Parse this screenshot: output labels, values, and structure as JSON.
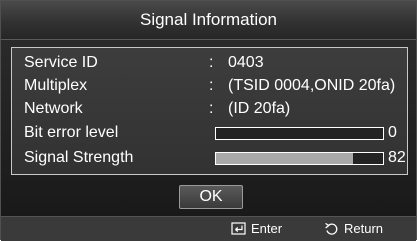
{
  "window": {
    "title": "Signal Information"
  },
  "info": {
    "rows": [
      {
        "label": "Service ID",
        "value": "0403"
      },
      {
        "label": "Multiplex",
        "value": "(TSID 0004,ONID 20fa)"
      },
      {
        "label": "Network",
        "value": "(ID 20fa)"
      }
    ],
    "bit_error": {
      "label": "Bit error level",
      "value": "0",
      "level": 0
    },
    "signal": {
      "label": "Signal Strength",
      "value": "82",
      "level": 82
    },
    "colon": ":"
  },
  "buttons": {
    "ok_label": "OK"
  },
  "footer": {
    "enter_icon": "enter-icon",
    "enter_label": "Enter",
    "return_icon": "return-icon",
    "return_label": "Return"
  },
  "colors": {
    "bar_fill": "#a9a9a9",
    "panel_border": "#c8c8c8"
  }
}
